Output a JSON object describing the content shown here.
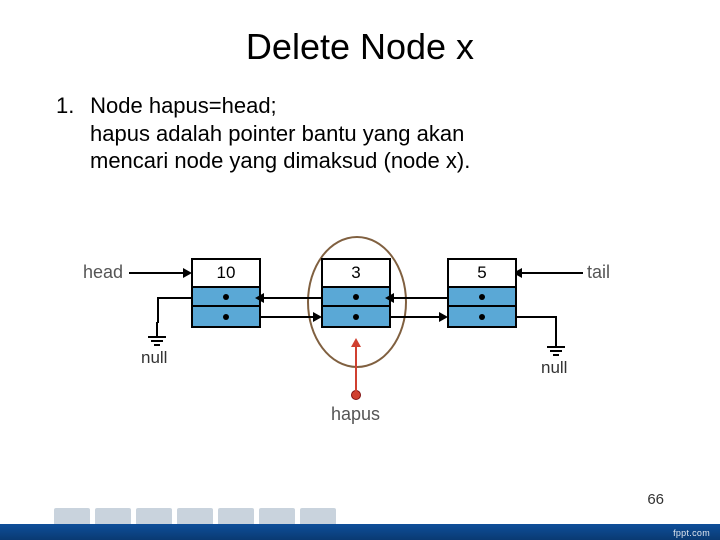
{
  "title": "Delete Node x",
  "list": {
    "num": "1.",
    "line1": "Node hapus=head;",
    "line2": "hapus adalah pointer bantu yang akan",
    "line3": "mencari node yang dimaksud (node x)."
  },
  "diagram": {
    "head": "head",
    "tail": "tail",
    "null": "null",
    "hapus": "hapus",
    "nodes": [
      {
        "value": "10"
      },
      {
        "value": "3"
      },
      {
        "value": "5"
      }
    ]
  },
  "page_number": "66",
  "watermark": "fppt.com"
}
